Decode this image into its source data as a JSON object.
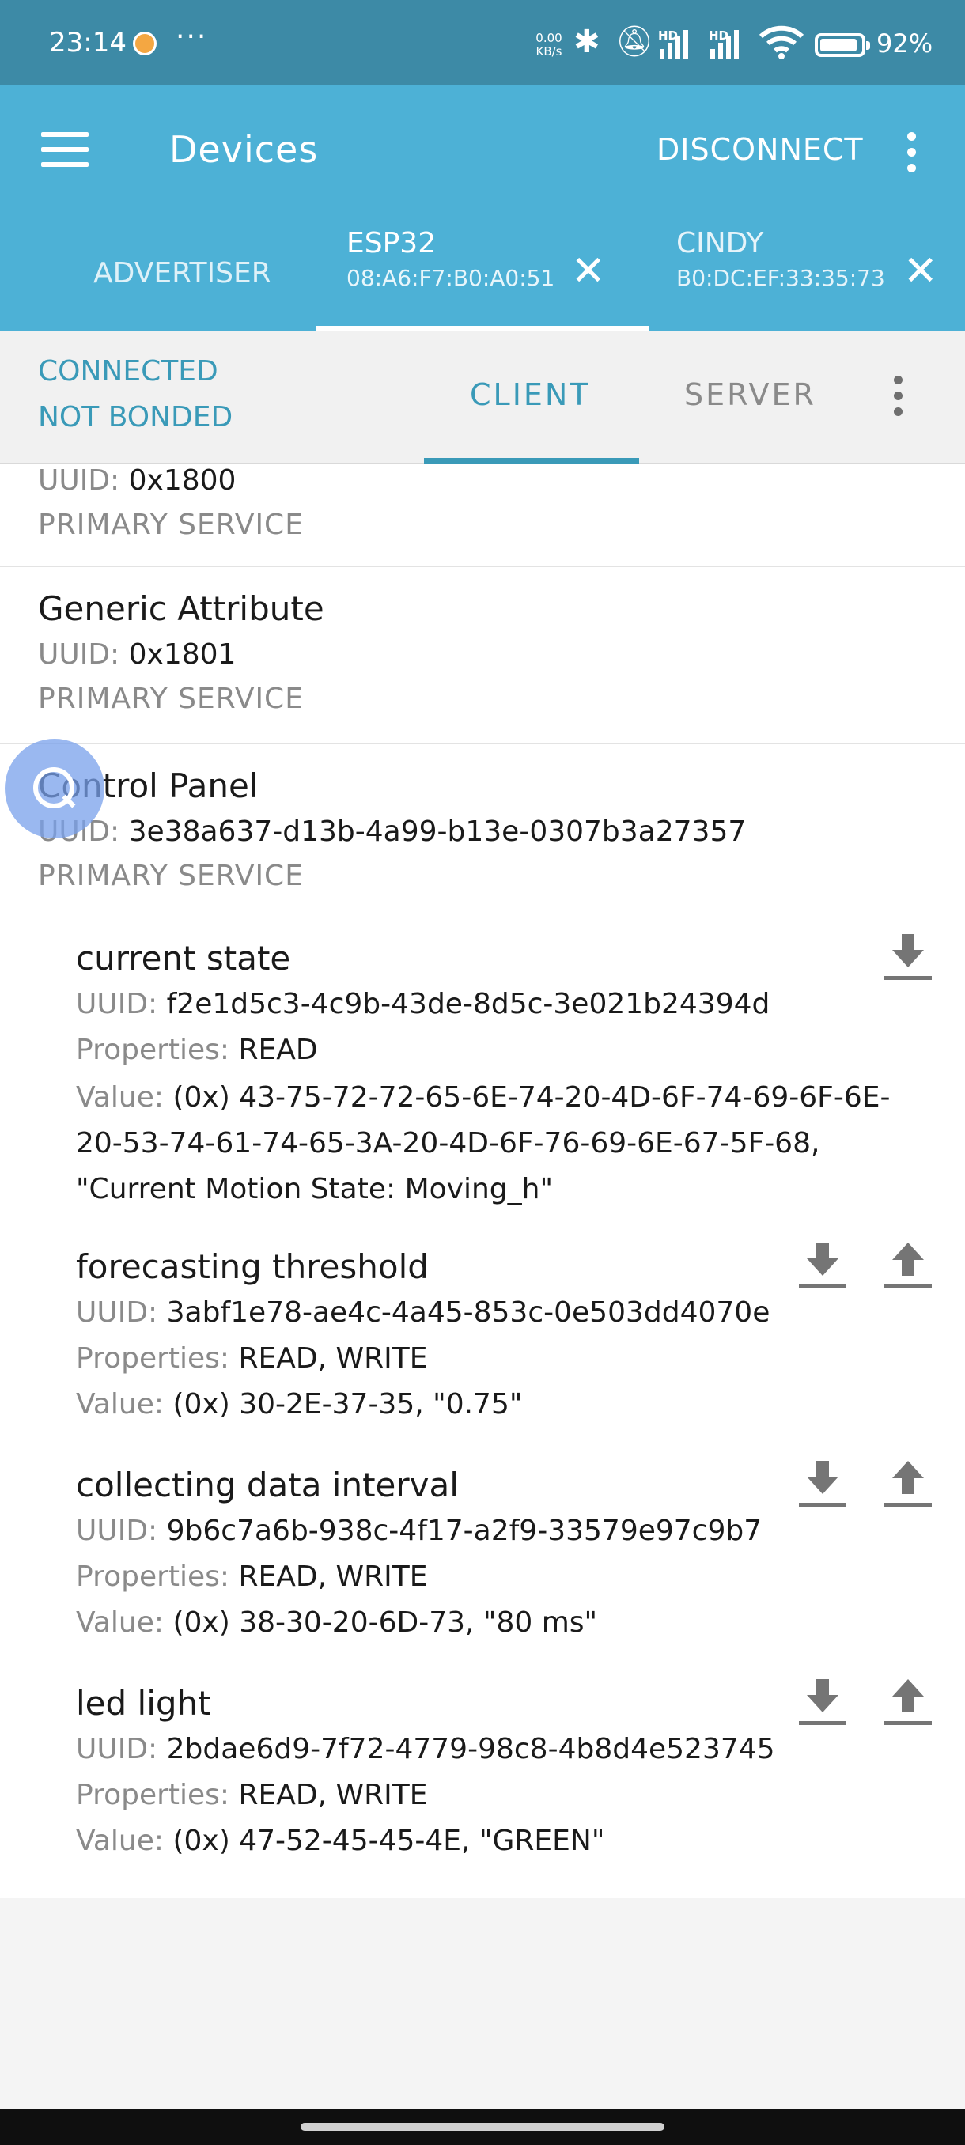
{
  "status_bar": {
    "time": "23:14",
    "more": "···",
    "net_speed_value": "0.00",
    "net_speed_unit": "KB/s",
    "hd1": "HD",
    "hd2": "HD",
    "battery_percent": "92",
    "battery_level": 0.92
  },
  "app_bar": {
    "title": "Devices",
    "disconnect_label": "DISCONNECT"
  },
  "device_tabs": [
    {
      "name": "ADVERTISER",
      "address": ""
    },
    {
      "name": "ESP32",
      "address": "08:A6:F7:B0:A0:51"
    },
    {
      "name": "CINDY",
      "address": "B0:DC:EF:33:35:73"
    }
  ],
  "connection": {
    "state": "CONNECTED",
    "bond": "NOT BONDED"
  },
  "mode_tabs": {
    "client": "CLIENT",
    "server": "SERVER"
  },
  "labels": {
    "uuid": "UUID:",
    "properties": "Properties:",
    "value": "Value:"
  },
  "services": [
    {
      "name": "",
      "uuid": "0x1800",
      "type": "PRIMARY SERVICE"
    },
    {
      "name": "Generic Attribute",
      "uuid": "0x1801",
      "type": "PRIMARY SERVICE"
    },
    {
      "name": "Control Panel",
      "uuid": "3e38a637-d13b-4a99-b13e-0307b3a27357",
      "type": "PRIMARY SERVICE"
    }
  ],
  "characteristics": [
    {
      "name": "current state",
      "uuid": "f2e1d5c3-4c9b-43de-8d5c-3e021b24394d",
      "properties": "READ",
      "value": "(0x) 43-75-72-72-65-6E-74-20-4D-6F-74-69-6F-6E-20-53-74-61-74-65-3A-20-4D-6F-76-69-6E-67-5F-68, \"Current Motion State: Moving_h\"",
      "actions": [
        "download-icon"
      ]
    },
    {
      "name": "forecasting threshold",
      "uuid": "3abf1e78-ae4c-4a45-853c-0e503dd4070e",
      "properties": "READ, WRITE",
      "value": "(0x) 30-2E-37-35, \"0.75\"",
      "actions": [
        "download-icon",
        "upload-icon"
      ]
    },
    {
      "name": "collecting data interval",
      "uuid": "9b6c7a6b-938c-4f17-a2f9-33579e97c9b7",
      "properties": "READ, WRITE",
      "value": "(0x) 38-30-20-6D-73, \"80 ms\"",
      "actions": [
        "download-icon",
        "upload-icon"
      ]
    },
    {
      "name": "led light",
      "uuid": "2bdae6d9-7f72-4779-98c8-4b8d4e523745",
      "properties": "READ, WRITE",
      "value": "(0x) 47-52-45-45-4E, \"GREEN\"",
      "actions": [
        "download-icon",
        "upload-icon"
      ]
    }
  ],
  "colors": {
    "status_bar": "#3d8aa6",
    "app_bar": "#4db1d6",
    "accent": "#3a9ab8",
    "muted_text": "#8a8a8a"
  }
}
